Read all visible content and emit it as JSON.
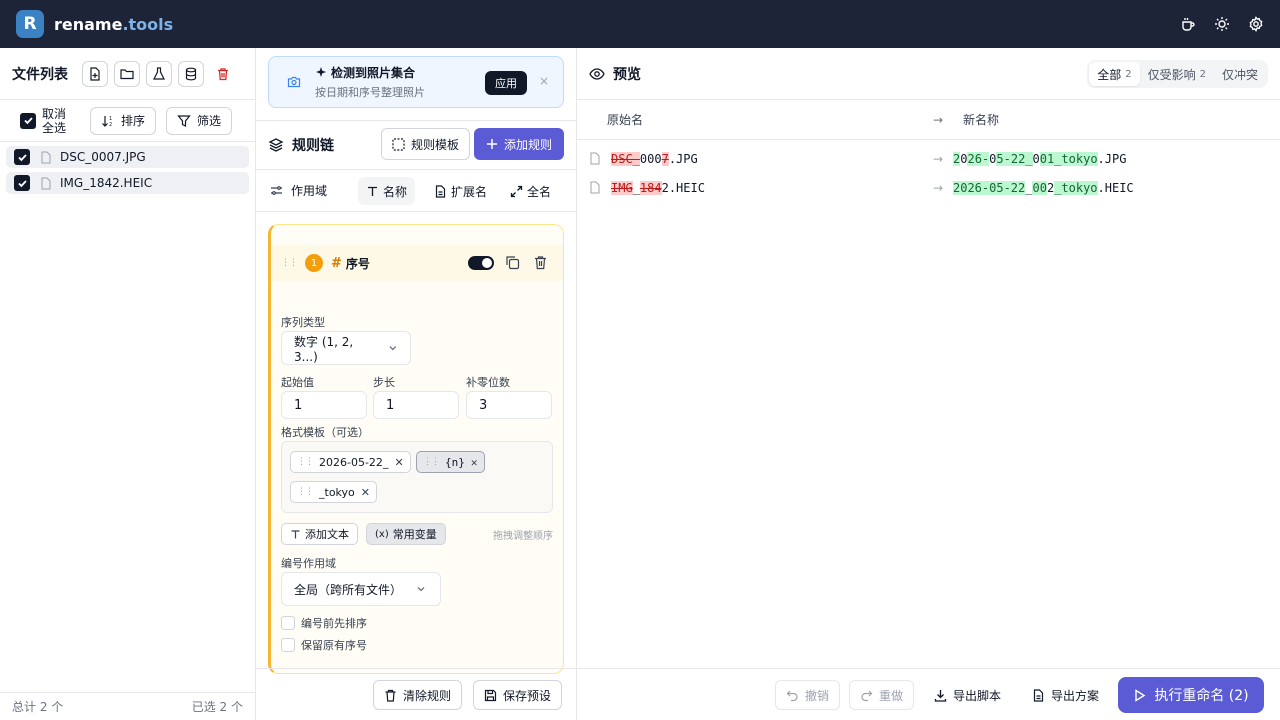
{
  "app": {
    "logo_letter": "R",
    "brand_name": "rename",
    "brand_suffix": ".tools"
  },
  "topbar": {
    "icons": [
      "coffee-icon",
      "sun-icon",
      "settings-icon"
    ]
  },
  "left": {
    "title": "文件列表",
    "select_all_line1": "取消",
    "select_all_line2": "全选",
    "sort_label": "排序",
    "filter_label": "筛选",
    "files": [
      {
        "name": "DSC_0007.JPG",
        "checked": true
      },
      {
        "name": "IMG_1842.HEIC",
        "checked": true
      }
    ],
    "total_label": "总计 2 个",
    "selected_label": "已选 2 个"
  },
  "detect": {
    "title": "检测到照片集合",
    "subtitle": "按日期和序号整理照片",
    "apply_label": "应用",
    "close": "×"
  },
  "chain": {
    "title": "规则链",
    "template_label": "规则模板",
    "add_label": "添加规则"
  },
  "scope": {
    "label": "作用域",
    "tabs": [
      {
        "label": "名称",
        "active": true
      },
      {
        "label": "扩展名",
        "active": false
      },
      {
        "label": "全名",
        "active": false
      }
    ]
  },
  "rule": {
    "index": "1",
    "hash": "#",
    "name": "序号",
    "enabled": true,
    "seq_type_label": "序列类型",
    "seq_type_value": "数字 (1, 2, 3...)",
    "start_label": "起始值",
    "start_value": "1",
    "step_label": "步长",
    "step_value": "1",
    "pad_label": "补零位数",
    "pad_value": "3",
    "format_label": "格式模板（可选）",
    "chips": [
      {
        "text": "2026-05-22_",
        "variable": false
      },
      {
        "text": "{n}",
        "variable": true
      },
      {
        "text": "_tokyo",
        "variable": false
      }
    ],
    "add_text_label": "添加文本",
    "common_vars_label": "常用变量",
    "drag_hint": "拖拽调整顺序",
    "numbering_scope_label": "编号作用域",
    "numbering_scope_value": "全局（跨所有文件）",
    "sort_first_label": "编号前先排序",
    "keep_original_label": "保留原有序号"
  },
  "mid_footer": {
    "clear_label": "清除规则",
    "save_label": "保存预设"
  },
  "preview": {
    "title": "预览",
    "filters": [
      {
        "label": "全部",
        "count": "2",
        "active": true
      },
      {
        "label": "仅受影响",
        "count": "2",
        "active": false
      },
      {
        "label": "仅冲突",
        "count": "",
        "active": false
      }
    ],
    "col_original": "原始名",
    "col_new": "新名称",
    "rows": [
      {
        "original": [
          {
            "t": "DSC_",
            "k": "del"
          },
          {
            "t": "000",
            "k": ""
          },
          {
            "t": "7",
            "k": "del"
          },
          {
            "t": ".JPG",
            "k": ""
          }
        ],
        "renamed": [
          {
            "t": "2",
            "k": "add"
          },
          {
            "t": "0",
            "k": ""
          },
          {
            "t": "26-",
            "k": "add"
          },
          {
            "t": "0",
            "k": ""
          },
          {
            "t": "5-22_",
            "k": "add"
          },
          {
            "t": "0",
            "k": ""
          },
          {
            "t": "01_tokyo",
            "k": "add"
          },
          {
            "t": ".JPG",
            "k": ""
          }
        ]
      },
      {
        "original": [
          {
            "t": "IMG",
            "k": "del"
          },
          {
            "t": "_",
            "k": ""
          },
          {
            "t": "184",
            "k": "del"
          },
          {
            "t": "2.HEIC",
            "k": ""
          }
        ],
        "renamed": [
          {
            "t": "2026-05-22",
            "k": "add"
          },
          {
            "t": "_",
            "k": ""
          },
          {
            "t": "00",
            "k": "add"
          },
          {
            "t": "2",
            "k": ""
          },
          {
            "t": "_tokyo",
            "k": "add"
          },
          {
            "t": ".HEIC",
            "k": ""
          }
        ]
      }
    ]
  },
  "right_footer": {
    "undo_label": "撤销",
    "redo_label": "重做",
    "export_script_label": "导出脚本",
    "export_plan_label": "导出方案",
    "run_label": "执行重命名 (2)"
  },
  "colors": {
    "topbar": "#1d2437",
    "accent": "#5b5bd6",
    "rule_accent": "#f5b731",
    "delete_bg": "#fecaca",
    "add_bg": "#bbf7d0"
  }
}
